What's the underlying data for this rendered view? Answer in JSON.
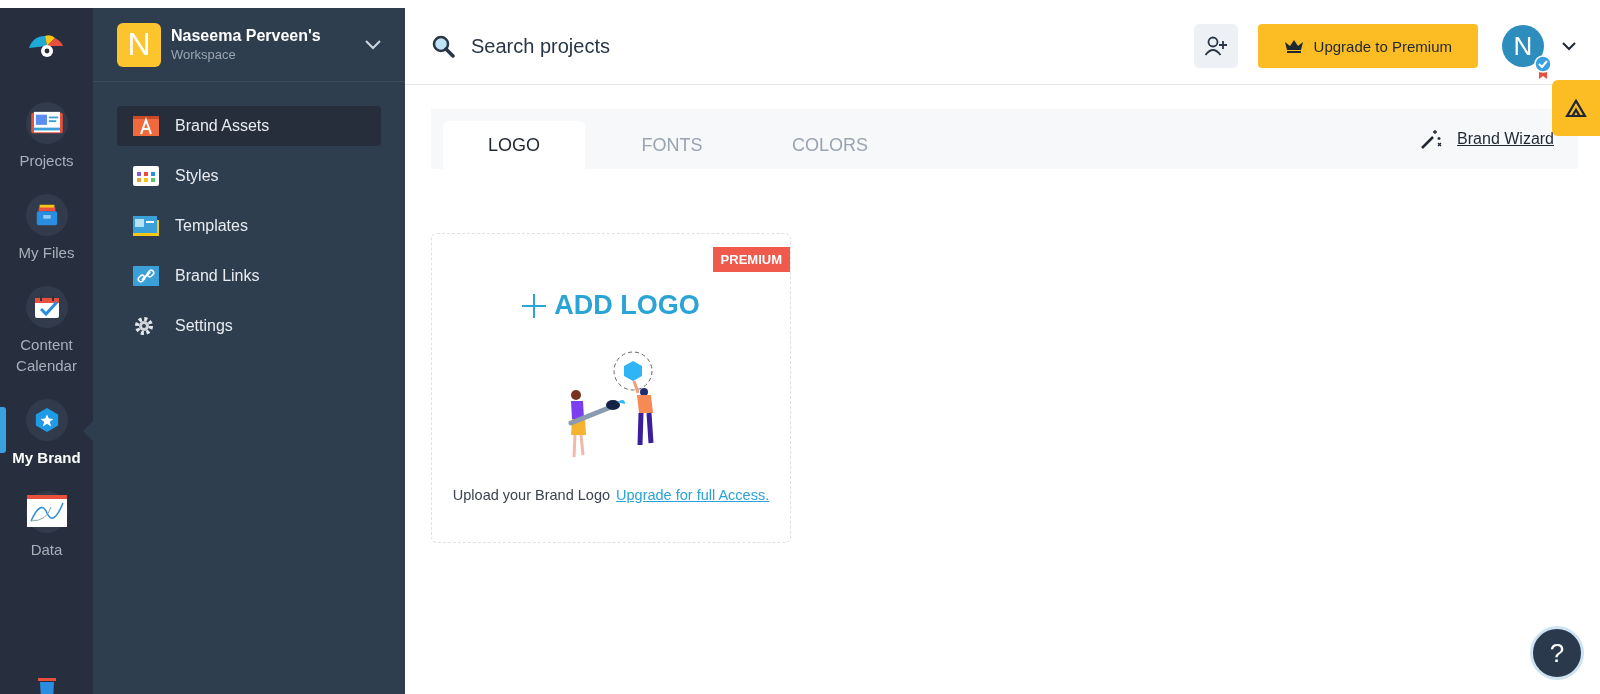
{
  "rail": {
    "items": [
      {
        "label": "Projects",
        "selected": false
      },
      {
        "label": "My Files",
        "selected": false
      },
      {
        "label": "Content Calendar",
        "selected": false
      },
      {
        "label": "My Brand",
        "selected": true
      },
      {
        "label": "Data",
        "selected": false
      }
    ]
  },
  "workspace": {
    "initial": "N",
    "name": "Naseema Perveen's",
    "subtitle": "Workspace"
  },
  "sidebar": {
    "items": [
      {
        "label": "Brand Assets",
        "selected": true
      },
      {
        "label": "Styles",
        "selected": false
      },
      {
        "label": "Templates",
        "selected": false
      },
      {
        "label": "Brand Links",
        "selected": false
      },
      {
        "label": "Settings",
        "selected": false
      }
    ]
  },
  "topbar": {
    "search": {
      "placeholder": "Search projects"
    },
    "upgrade_button": "Upgrade to Premium",
    "avatar_initial": "N"
  },
  "tabs": [
    {
      "label": "LOGO",
      "selected": true
    },
    {
      "label": "FONTS",
      "selected": false
    },
    {
      "label": "COLORS",
      "selected": false
    }
  ],
  "brand_wizard": "Brand Wizard",
  "logo_card": {
    "badge": "PREMIUM",
    "add_label": "ADD LOGO",
    "caption": "Upload your Brand Logo",
    "link": "Upgrade for full Access."
  },
  "help_button": "?"
}
